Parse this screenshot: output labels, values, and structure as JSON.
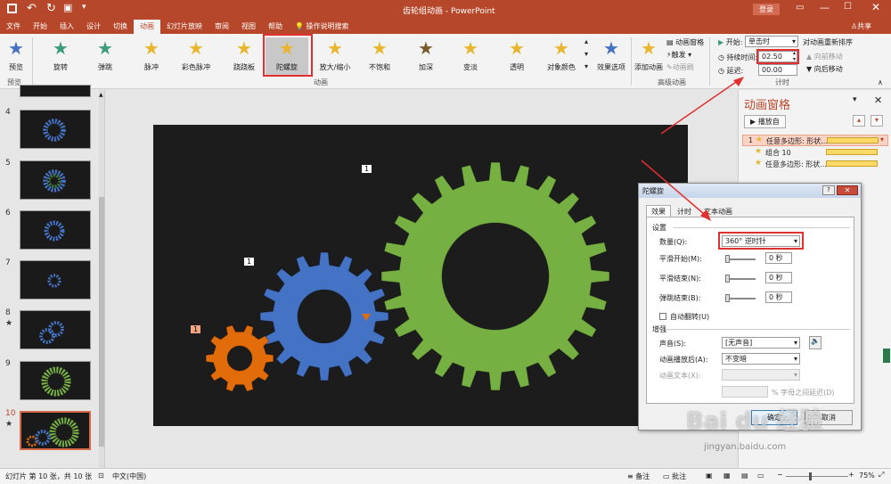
{
  "title_bar": {
    "doc_title": "齿轮组动画",
    "app_name": "PowerPoint",
    "login_label": "登录",
    "share_label": "共享",
    "qat_icons": [
      "save-icon",
      "undo-icon",
      "redo-icon",
      "present-icon",
      "dropdown-icon"
    ]
  },
  "tabs": [
    "文件",
    "开始",
    "插入",
    "设计",
    "切换",
    "动画",
    "幻灯片放映",
    "审阅",
    "视图",
    "帮助"
  ],
  "tell_me": "操作说明搜索",
  "active_tab_index": 5,
  "ribbon": {
    "preview_label": "预览",
    "preview_group": "预览",
    "effects": [
      "旋转",
      "弹跳",
      "脉冲",
      "彩色脉冲",
      "跷跷板",
      "陀螺旋",
      "放大/缩小",
      "不饱和",
      "加深",
      "变淡",
      "透明",
      "对象颜色"
    ],
    "effect_colors": [
      "#3c9b7a",
      "#3c9b7a",
      "#e9b52c",
      "#e9b52c",
      "#e9b52c",
      "#e9b52c",
      "#e9b52c",
      "#e9b52c",
      "#7a5a2a",
      "#e9b52c",
      "#e9b52c",
      "#e9b52c"
    ],
    "selected_effect_index": 5,
    "effect_options": "效果选项",
    "anim_group": "动画",
    "add_anim": "添加动画",
    "anim_pane": "动画窗格",
    "trigger": "触发",
    "painter": "动画刷",
    "adv_group": "高级动画",
    "start_label": "开始:",
    "start_value": "单击时",
    "duration_label": "持续时间:",
    "duration_value": "02.50",
    "delay_label": "延迟:",
    "delay_value": "00.00",
    "reorder": "对动画重新排序",
    "move_earlier": "向前移动",
    "move_later": "向后移动",
    "timing_group": "计时"
  },
  "thumbnails": [
    {
      "num": "4",
      "star": ""
    },
    {
      "num": "5",
      "star": ""
    },
    {
      "num": "6",
      "star": ""
    },
    {
      "num": "7",
      "star": ""
    },
    {
      "num": "8",
      "star": "★"
    },
    {
      "num": "9",
      "star": ""
    },
    {
      "num": "10",
      "star": "★"
    }
  ],
  "slide_tags": [
    "1",
    "1",
    "1"
  ],
  "anim_pane": {
    "title": "动画窗格",
    "play_label": "播放自",
    "items": [
      {
        "num": "1",
        "label": "任意多边形: 形状..."
      },
      {
        "num": "",
        "label": "组合 10"
      },
      {
        "num": "",
        "label": "任意多边形: 形状..."
      }
    ]
  },
  "dialog": {
    "title": "陀螺旋",
    "tabs": [
      "效果",
      "计时",
      "文本动画"
    ],
    "settings_header": "设置",
    "amount_label": "数量(Q):",
    "amount_value": "360° 逆时针",
    "smooth_start_label": "平滑开始(M):",
    "smooth_start_value": "0 秒",
    "smooth_end_label": "平滑结束(N):",
    "smooth_end_value": "0 秒",
    "bounce_end_label": "弹跳结束(B):",
    "bounce_end_value": "0 秒",
    "auto_reverse_label": "自动翻转(U)",
    "enhance_header": "增强",
    "sound_label": "声音(S):",
    "sound_value": "[无声音]",
    "after_anim_label": "动画播放后(A):",
    "after_anim_value": "不变暗",
    "text_anim_label": "动画文本(X):",
    "delay_letters": "% 字母之间延迟(D)",
    "ok_label": "确定",
    "cancel_label": "取消"
  },
  "status": {
    "slide_info": "幻灯片 第 10 张，共 10 张",
    "language": "中文(中国)",
    "notes": "备注",
    "comments": "批注",
    "zoom": "75%"
  },
  "watermark": {
    "brand": "Bai du 经验",
    "url": "jingyan.baidu.com"
  },
  "colors": {
    "accent": "#b7472a",
    "green_gear": "#76b043",
    "blue_gear": "#4472c4",
    "orange_gear": "#e36c0a",
    "highlight": "#e03030"
  }
}
